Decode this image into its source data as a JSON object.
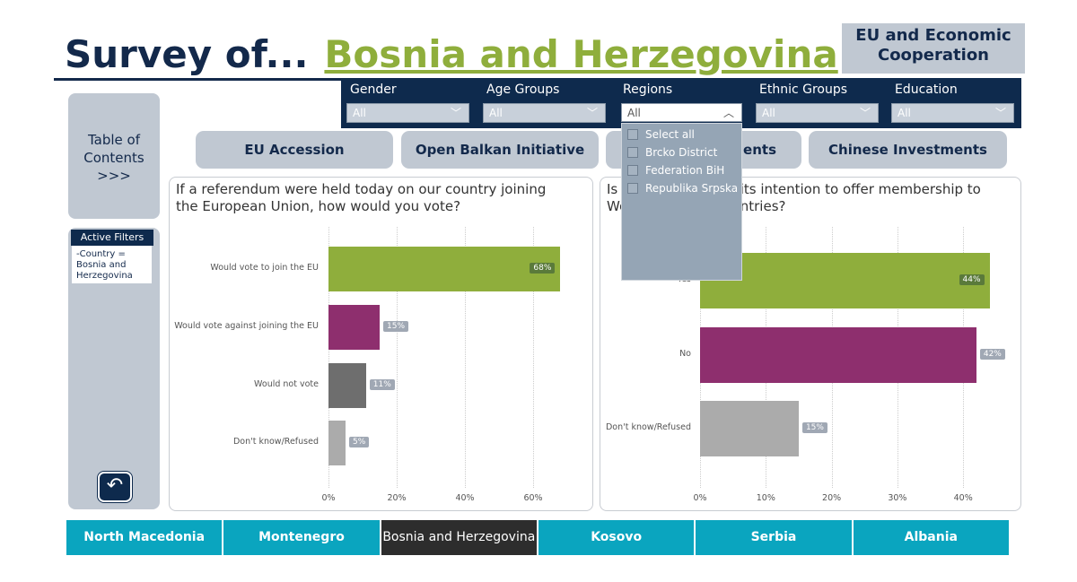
{
  "header": {
    "title_prefix": "Survey of...",
    "country": "Bosnia and Herzegovina",
    "section": "EU and Economic Cooperation"
  },
  "filters": [
    {
      "label": "Gender",
      "value": "All"
    },
    {
      "label": "Age Groups",
      "value": "All"
    },
    {
      "label": "Regions",
      "value": "All"
    },
    {
      "label": "Ethnic Groups",
      "value": "All"
    },
    {
      "label": "Education",
      "value": "All"
    }
  ],
  "regions_dropdown": {
    "options": [
      "Select all",
      "Brcko District",
      "Federation BiH",
      "Republika Srpska"
    ]
  },
  "sidebar": {
    "toc": "Table of Contents >>>",
    "active_filters_title": "Active Filters",
    "active_filters_text": "-Country = Bosnia and Herzegovina",
    "back_icon": "back-arrow-icon"
  },
  "tabs": [
    "EU Accession",
    "Open Balkan Initiative",
    "Investments",
    "Chinese Investments"
  ],
  "colors": {
    "navy": "#0e2a4d",
    "green": "#8fae3c",
    "magenta": "#8e2f6e",
    "darkgray": "#6e6e6e",
    "lightgray": "#ababab",
    "teal": "#0aa5bf"
  },
  "chart_data": [
    {
      "type": "bar",
      "orientation": "horizontal",
      "title": "If a referendum were held today on our country joining the European Union, how would you vote?",
      "categories": [
        "Would vote to join the EU",
        "Would vote against joining the EU",
        "Would not vote",
        "Don't know/Refused"
      ],
      "values": [
        68,
        15,
        11,
        5
      ],
      "data_labels": [
        "68%",
        "15%",
        "11%",
        "5%"
      ],
      "bar_colors": [
        "#8fae3c",
        "#8e2f6e",
        "#6e6e6e",
        "#ababab"
      ],
      "xlim": [
        0,
        70
      ],
      "xticks": [
        "0%",
        "20%",
        "40%",
        "60%"
      ],
      "grid": true
    },
    {
      "type": "bar",
      "orientation": "horizontal",
      "title": "Is the EU serious in its intention to offer membership to Western Balkan countries?",
      "categories": [
        "Yes",
        "No",
        "Don't know/Refused"
      ],
      "values": [
        44,
        42,
        15
      ],
      "data_labels": [
        "44%",
        "42%",
        "15%"
      ],
      "bar_colors": [
        "#8fae3c",
        "#8e2f6e",
        "#ababab"
      ],
      "xlim": [
        0,
        45
      ],
      "xticks": [
        "0%",
        "10%",
        "20%",
        "30%",
        "40%"
      ],
      "grid": true
    }
  ],
  "nav": [
    "North Macedonia",
    "Montenegro",
    "Bosnia and Herzegovina",
    "Kosovo",
    "Serbia",
    "Albania"
  ],
  "nav_active": 2
}
